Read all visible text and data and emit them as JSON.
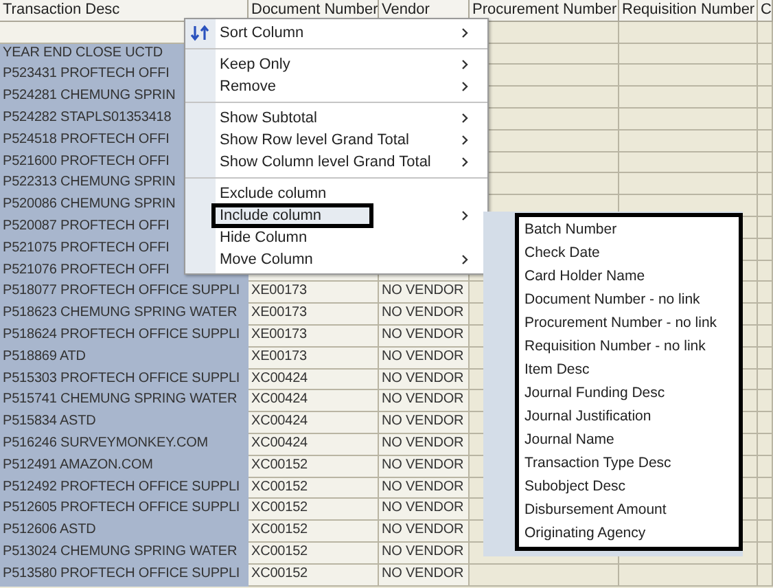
{
  "table": {
    "columns": [
      {
        "label": "Transaction Desc",
        "selected": true
      },
      {
        "label": "Document Number",
        "selected": false
      },
      {
        "label": "Vendor",
        "selected": false
      },
      {
        "label": "Procurement Number",
        "selected": false
      },
      {
        "label": "Requisition Number",
        "selected": false
      },
      {
        "label": "C",
        "selected": false
      }
    ],
    "rows": [
      {
        "transaction_desc": "YEAR END CLOSE UCTD"
      },
      {
        "transaction_desc": "P523431 PROFTECH OFFI"
      },
      {
        "transaction_desc": "P524281 CHEMUNG SPRIN"
      },
      {
        "transaction_desc": "P524282 STAPLS01353418"
      },
      {
        "transaction_desc": "P524518 PROFTECH OFFI"
      },
      {
        "transaction_desc": "P521600 PROFTECH OFFI"
      },
      {
        "transaction_desc": "P522313 CHEMUNG SPRIN"
      },
      {
        "transaction_desc": "P520086 CHEMUNG SPRIN"
      },
      {
        "transaction_desc": "P520087 PROFTECH OFFI"
      },
      {
        "transaction_desc": "P521075 PROFTECH OFFI"
      },
      {
        "transaction_desc": "P521076 PROFTECH OFFI"
      },
      {
        "transaction_desc": "P518077 PROFTECH OFFICE SUPPLI",
        "document_number": "XE00173",
        "vendor": "NO VENDOR"
      },
      {
        "transaction_desc": "P518623 CHEMUNG SPRING WATER",
        "document_number": "XE00173",
        "vendor": "NO VENDOR"
      },
      {
        "transaction_desc": "P518624 PROFTECH OFFICE SUPPLI",
        "document_number": "XE00173",
        "vendor": "NO VENDOR"
      },
      {
        "transaction_desc": "P518869 ATD",
        "document_number": "XE00173",
        "vendor": "NO VENDOR"
      },
      {
        "transaction_desc": "P515303 PROFTECH OFFICE SUPPLI",
        "document_number": "XC00424",
        "vendor": "NO VENDOR"
      },
      {
        "transaction_desc": "P515741 CHEMUNG SPRING WATER",
        "document_number": "XC00424",
        "vendor": "NO VENDOR"
      },
      {
        "transaction_desc": "P515834 ASTD",
        "document_number": "XC00424",
        "vendor": "NO VENDOR"
      },
      {
        "transaction_desc": "P516246 SURVEYMONKEY.COM",
        "document_number": "XC00424",
        "vendor": "NO VENDOR"
      },
      {
        "transaction_desc": "P512491 AMAZON.COM",
        "document_number": "XC00152",
        "vendor": "NO VENDOR"
      },
      {
        "transaction_desc": "P512492 PROFTECH OFFICE SUPPLI",
        "document_number": "XC00152",
        "vendor": "NO VENDOR"
      },
      {
        "transaction_desc": "P512605 PROFTECH OFFICE SUPPLI",
        "document_number": "XC00152",
        "vendor": "NO VENDOR"
      },
      {
        "transaction_desc": "P512606 ASTD",
        "document_number": "XC00152",
        "vendor": "NO VENDOR"
      },
      {
        "transaction_desc": "P513024 CHEMUNG SPRING WATER",
        "document_number": "XC00152",
        "vendor": "NO VENDOR"
      },
      {
        "transaction_desc": "P513580 PROFTECH OFFICE SUPPLI",
        "document_number": "XC00152",
        "vendor": "NO VENDOR"
      }
    ]
  },
  "context_menu": {
    "groups": [
      [
        {
          "label": "Sort Column",
          "has_icon": true,
          "has_submenu": true,
          "selected": false
        }
      ],
      [
        {
          "label": "Keep Only",
          "has_icon": false,
          "has_submenu": true,
          "selected": false
        },
        {
          "label": "Remove",
          "has_icon": false,
          "has_submenu": true,
          "selected": false
        }
      ],
      [
        {
          "label": "Show Subtotal",
          "has_icon": false,
          "has_submenu": true,
          "selected": false
        },
        {
          "label": "Show Row level Grand Total",
          "has_icon": false,
          "has_submenu": true,
          "selected": false
        },
        {
          "label": "Show Column level Grand Total",
          "has_icon": false,
          "has_submenu": true,
          "selected": false
        }
      ],
      [
        {
          "label": "Exclude column",
          "has_icon": false,
          "has_submenu": false,
          "selected": false
        },
        {
          "label": "Include column",
          "has_icon": false,
          "has_submenu": true,
          "selected": true
        },
        {
          "label": "Hide Column",
          "has_icon": false,
          "has_submenu": false,
          "selected": false
        },
        {
          "label": "Move Column",
          "has_icon": false,
          "has_submenu": true,
          "selected": false
        }
      ]
    ]
  },
  "submenu": {
    "items": [
      "Batch Number",
      "Check Date",
      "Card Holder Name",
      "Document Number - no link",
      "Procurement Number - no link",
      "Requisition Number - no link",
      "Item Desc",
      "Journal Funding Desc",
      "Journal Justification",
      "Journal Name",
      "Transaction Type Desc",
      "Subobject Desc",
      "Disbursement Amount",
      "Originating Agency"
    ]
  }
}
